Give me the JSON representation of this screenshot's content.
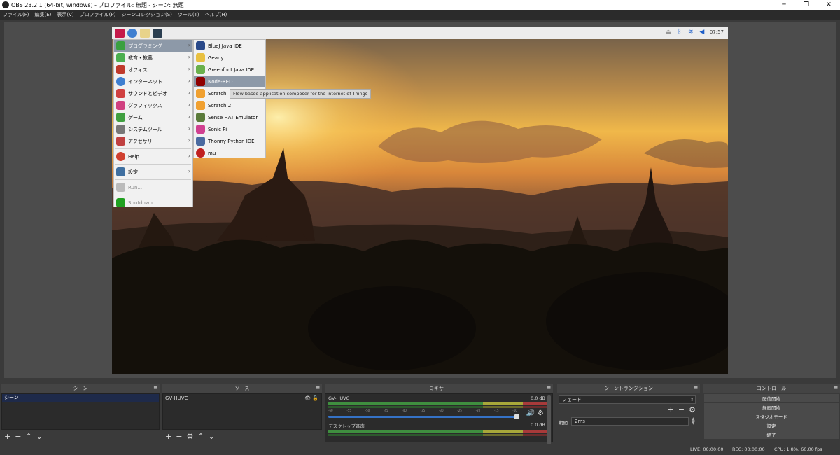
{
  "window": {
    "title": "OBS 23.2.1 (64-bit, windows) - プロファイル: 無題 - シーン: 無題",
    "controls": [
      "─",
      "❐",
      "✕"
    ]
  },
  "menubar": [
    "ファイル(F)",
    "編集(E)",
    "表示(V)",
    "プロファイル(P)",
    "シーンコレクション(S)",
    "ツール(T)",
    "ヘルプ(H)"
  ],
  "pi": {
    "clock": "07:57",
    "menu": [
      {
        "label": "プログラミング",
        "icon": "programming-icon",
        "color": "#3aa040",
        "submenu": true,
        "selected": true
      },
      {
        "label": "教育・教養",
        "icon": "education-icon",
        "color": "#4caf50",
        "submenu": true
      },
      {
        "label": "オフィス",
        "icon": "office-icon",
        "color": "#c0392b",
        "submenu": true
      },
      {
        "label": "インターネット",
        "icon": "internet-icon",
        "color": "#3f7fd0",
        "submenu": true
      },
      {
        "label": "サウンドとビデオ",
        "icon": "sound-video-icon",
        "color": "#d04040",
        "submenu": true
      },
      {
        "label": "グラフィックス",
        "icon": "graphics-icon",
        "color": "#d04080",
        "submenu": true
      },
      {
        "label": "ゲーム",
        "icon": "game-icon",
        "color": "#40a040",
        "submenu": true
      },
      {
        "label": "システムツール",
        "icon": "system-tools-icon",
        "color": "#777777",
        "submenu": true
      },
      {
        "label": "アクセサリ",
        "icon": "accessories-icon",
        "color": "#c04040",
        "submenu": true
      },
      {
        "label": "Help",
        "icon": "help-icon",
        "color": "#d04030",
        "submenu": true
      },
      {
        "label": "設定",
        "icon": "settings-icon",
        "color": "#3f6fa0",
        "submenu": true
      },
      {
        "label": "Run...",
        "icon": "run-icon",
        "color": "#888888",
        "submenu": false
      },
      {
        "label": "Shutdown...",
        "icon": "shutdown-icon",
        "color": "#20a020",
        "submenu": false
      }
    ],
    "submenu": [
      {
        "label": "BlueJ Java IDE",
        "icon": "bluej-icon",
        "color": "#2a4a8a"
      },
      {
        "label": "Geany",
        "icon": "geany-icon",
        "color": "#e8c040"
      },
      {
        "label": "Greenfoot Java IDE",
        "icon": "greenfoot-icon",
        "color": "#6ab04c"
      },
      {
        "label": "Node-RED",
        "icon": "node-red-icon",
        "color": "#8f0000",
        "selected": true
      },
      {
        "label": "Scratch",
        "icon": "scratch-icon",
        "color": "#f0a030"
      },
      {
        "label": "Scratch 2",
        "icon": "scratch2-icon",
        "color": "#f0a030"
      },
      {
        "label": "Sense HAT Emulator",
        "icon": "sense-hat-icon",
        "color": "#5a7a3a"
      },
      {
        "label": "Sonic Pi",
        "icon": "sonic-pi-icon",
        "color": "#d04090"
      },
      {
        "label": "Thonny Python IDE",
        "icon": "thonny-icon",
        "color": "#4a6aa0"
      },
      {
        "label": "mu",
        "icon": "mu-icon",
        "color": "#c02020"
      }
    ],
    "tooltip": "Flow based application composer for the Internet of Things"
  },
  "docks": {
    "scenes": {
      "title": "シーン",
      "items": [
        "シーン"
      ]
    },
    "sources": {
      "title": "ソース",
      "items": [
        "GV-HUVC"
      ]
    },
    "mixer": {
      "title": "ミキサー",
      "channels": [
        {
          "name": "GV-HUVC",
          "db": "0.0 dB"
        },
        {
          "name": "デスクトップ音声",
          "db": "0.0 dB"
        }
      ],
      "scale": [
        "-60",
        "-55",
        "-50",
        "-45",
        "-40",
        "-35",
        "-30",
        "-25",
        "-20",
        "-15",
        "-10",
        "-5",
        "0"
      ]
    },
    "transitions": {
      "title": "シーントランジション",
      "transition": "フェード",
      "duration_label": "期間",
      "duration": "2ms"
    },
    "controls": {
      "title": "コントロール",
      "buttons": [
        "配信開始",
        "録画開始",
        "スタジオモード",
        "設定",
        "終了"
      ]
    }
  },
  "status": {
    "live": "LIVE: 00:00:00",
    "rec": "REC: 00:00:00",
    "cpu": "CPU: 1.8%, 60.00 fps"
  }
}
